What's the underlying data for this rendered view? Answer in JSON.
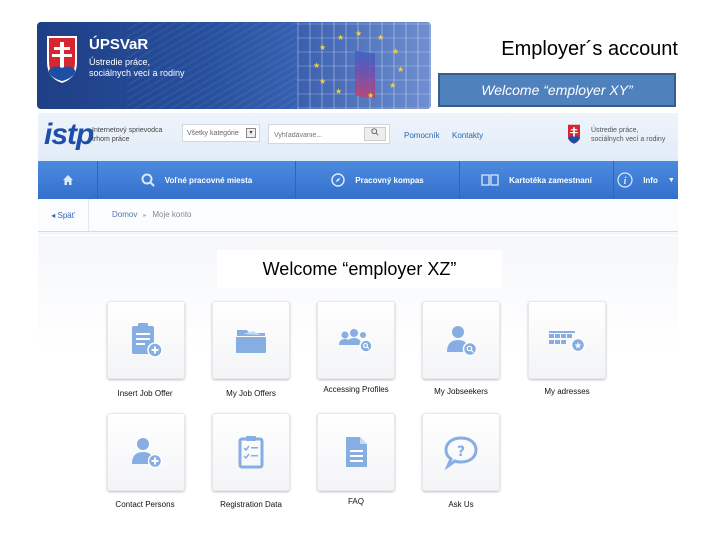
{
  "banner": {
    "brand": "ÚPSVaR",
    "subtitle_line1": "Ústredie práce,",
    "subtitle_line2": "sociálnych vecí a rodiny"
  },
  "slide": {
    "title": "Employer´s account",
    "welcome_box": "Welcome “employer XY”",
    "welcome_main": "Welcome “employer XZ”"
  },
  "portal": {
    "logo": "istp",
    "tagline_line1": "Internetový sprievodca",
    "tagline_line2": "trhom práce",
    "category_select": "Všetky kategórie",
    "search_placeholder": "Vyhľadávanie...",
    "search_icon": "search-icon",
    "links": [
      "Pomocník",
      "Kontakty"
    ],
    "gov_line1": "Ústredie práce,",
    "gov_line2": "sociálnych vecí a rodiny",
    "nav": [
      {
        "label": "",
        "icon": "home-icon"
      },
      {
        "label": "Voľné pracovné miesta",
        "icon": "search-icon"
      },
      {
        "label": "Pracovný kompas",
        "icon": "compass-icon"
      },
      {
        "label": "Kartotéka zamestnaní",
        "icon": "book-icon"
      },
      {
        "label": "Info",
        "icon": "info-icon"
      }
    ],
    "back_label": "◂ Späť",
    "breadcrumb": [
      "Domov",
      "Moje konto"
    ],
    "accent_color": "#3a78d4"
  },
  "tiles": [
    {
      "label": "Insert Job Offer",
      "icon": "clipboard-add-icon"
    },
    {
      "label": "My Job Offers",
      "icon": "folder-icon"
    },
    {
      "label": "Accessing Profiles",
      "icon": "group-search-icon"
    },
    {
      "label": "My Jobseekers",
      "icon": "user-search-icon"
    },
    {
      "label": "My adresses",
      "icon": "address-grid-star-icon"
    },
    {
      "label": "Contact Persons",
      "icon": "user-add-icon"
    },
    {
      "label": "Registration Data",
      "icon": "clipboard-checklist-icon"
    },
    {
      "label": "FAQ",
      "icon": "document-icon"
    },
    {
      "label": "Ask Us",
      "icon": "question-bubble-icon"
    }
  ],
  "icon_color": "#86aee3"
}
